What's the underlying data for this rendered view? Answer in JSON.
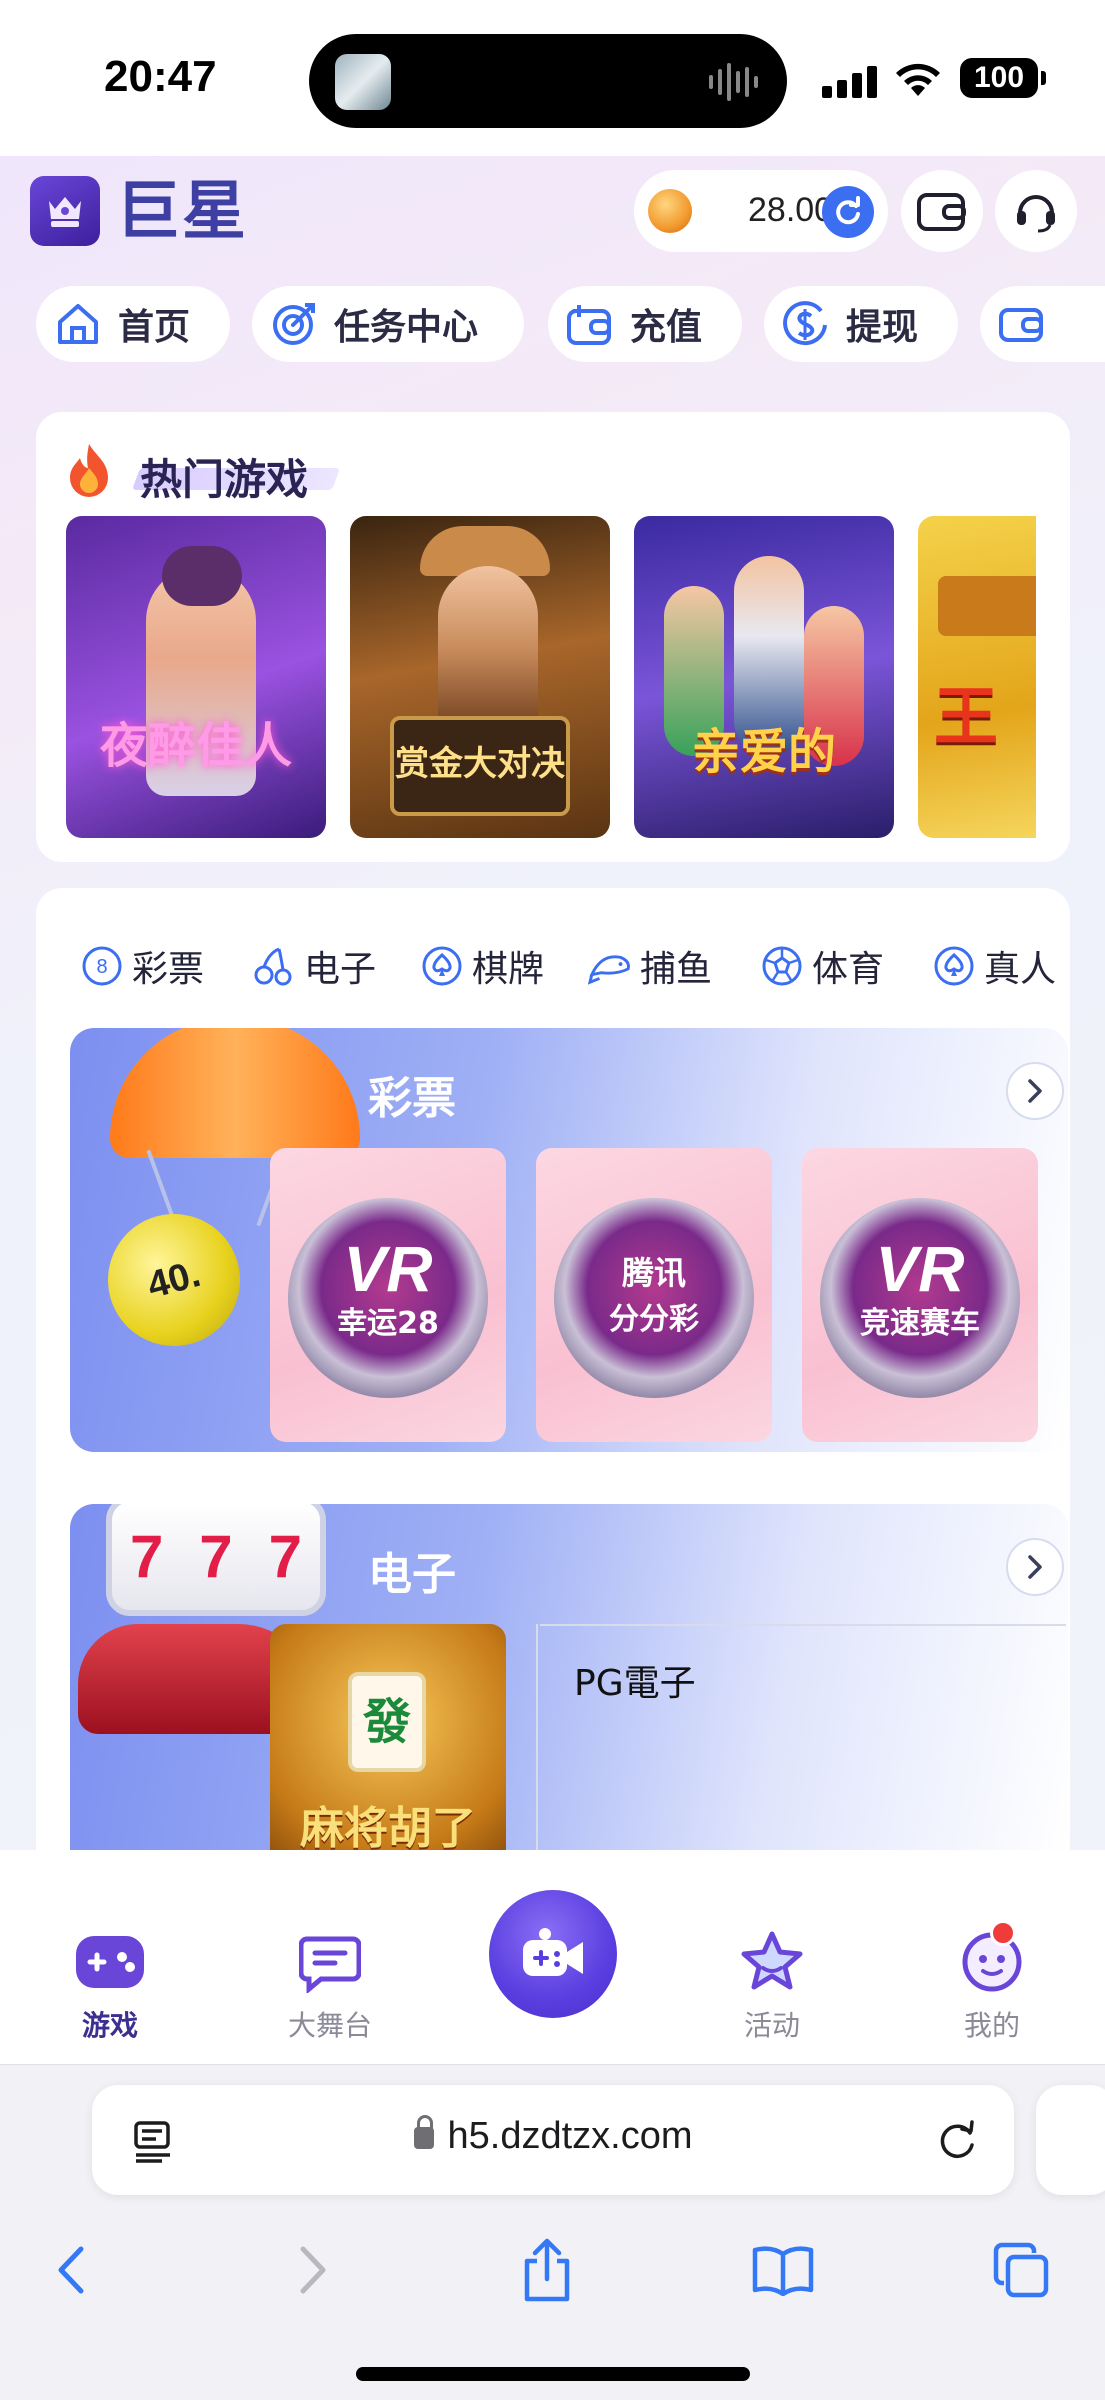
{
  "status_bar": {
    "time": "20:47",
    "battery": "100"
  },
  "header": {
    "app_name": "巨星",
    "balance": "28.00",
    "icons": [
      "crown-shield-logo-icon",
      "coin-icon",
      "refresh-icon",
      "wallet-icon",
      "headset-icon"
    ]
  },
  "quick_nav": [
    {
      "label": "首页",
      "icon": "home-icon"
    },
    {
      "label": "任务中心",
      "icon": "target-icon"
    },
    {
      "label": "充值",
      "icon": "wallet-plus-icon"
    },
    {
      "label": "提现",
      "icon": "dollar-circle-icon"
    },
    {
      "label": "",
      "icon": "wallet-icon"
    }
  ],
  "hot_games": {
    "title": "热门游戏",
    "games": [
      {
        "name": "夜醉佳人",
        "bg": "#7b3fc4",
        "accent": "#ff8ae0"
      },
      {
        "name": "赏金大对决",
        "bg": "#8a5416",
        "accent": "#ffe08a"
      },
      {
        "name": "亲爱的",
        "bg": "#5a3bb8",
        "accent": "#ffd24a"
      },
      {
        "name": "王",
        "bg": "#d4a21a",
        "accent": "#e8341c"
      }
    ]
  },
  "categories": {
    "tabs": [
      {
        "label": "彩票",
        "icon": "lottery-8-ball-icon"
      },
      {
        "label": "电子",
        "icon": "cherries-icon"
      },
      {
        "label": "棋牌",
        "icon": "spade-icon"
      },
      {
        "label": "捕鱼",
        "icon": "fish-icon"
      },
      {
        "label": "体育",
        "icon": "soccer-ball-icon"
      },
      {
        "label": "真人",
        "icon": "spade-icon"
      }
    ],
    "lottery": {
      "title": "彩票",
      "ball_number": "40.",
      "items": [
        {
          "badge": "VR",
          "name": "幸运28"
        },
        {
          "badge": "腾讯",
          "name": "分分彩"
        },
        {
          "badge": "VR",
          "name": "竞速赛车"
        }
      ]
    },
    "electronic": {
      "title": "电子",
      "slot_digits": [
        "7",
        "7",
        "7"
      ],
      "featured_tile": {
        "tile_char": "發",
        "name": "麻将胡了"
      },
      "provider": "PG電子"
    }
  },
  "tabbar": {
    "items": [
      {
        "label": "游戏",
        "icon": "gamepad-icon",
        "active": true
      },
      {
        "label": "大舞台",
        "icon": "chat-bubble-icon",
        "active": false
      },
      {
        "label": "",
        "icon": "video-game-icon",
        "active": false
      },
      {
        "label": "活动",
        "icon": "star-icon",
        "active": false
      },
      {
        "label": "我的",
        "icon": "smiley-icon",
        "active": false
      }
    ]
  },
  "browser": {
    "url": "h5.dzdtzx.com"
  }
}
